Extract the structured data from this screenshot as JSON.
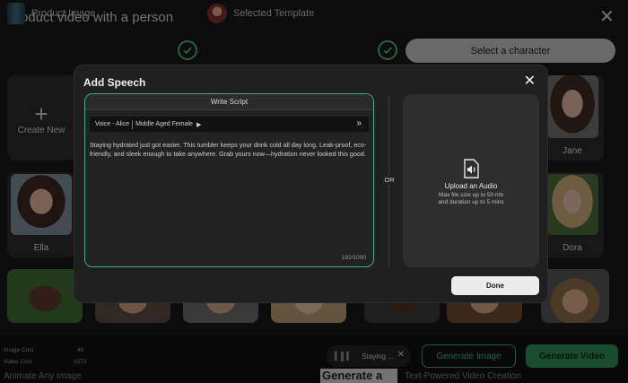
{
  "header": {
    "title": "Product video with a person"
  },
  "steps": [
    {
      "label": "Product Image"
    },
    {
      "label": "Selected Template"
    },
    {
      "label": "Select a character"
    }
  ],
  "grid": {
    "create_label": "Create New",
    "names": {
      "ella": "Ella",
      "jane": "Jane",
      "dora": "Dora"
    }
  },
  "modal": {
    "title": "Add Speech",
    "write_script_label": "Write Script",
    "voice_name": "Voice - Alice",
    "voice_type": "Middle Aged Female",
    "script_text": "Staying hydrated just got easier. This tumbler keeps your drink cold all day long. Leak-proof, eco-friendly, and sleek enough to take anywhere. Grab yours now—hydration never looked this good.",
    "char_count": "192/1000",
    "or_label": "OR",
    "upload_title": "Upload an Audio",
    "upload_hint_1": "Max file size up to 50 mb",
    "upload_hint_2": "and duration up to 5 mins",
    "done_label": "Done"
  },
  "bottom": {
    "image_cost_label": "Image Cost",
    "image_cost_value": "40",
    "video_cost_label": "Video Cost",
    "video_cost_value": "1572",
    "audio_pill_text": "Staying ...",
    "generate_image": "Generate Image",
    "generate_video": "Generate Video",
    "bg_text_1": "Animate Any Image",
    "bg_text_2": "Generate a",
    "bg_text_3": "Text-Powered Video Creation"
  },
  "colors": {
    "accent": "#3fae82",
    "primary_button": "#2e8b57"
  }
}
